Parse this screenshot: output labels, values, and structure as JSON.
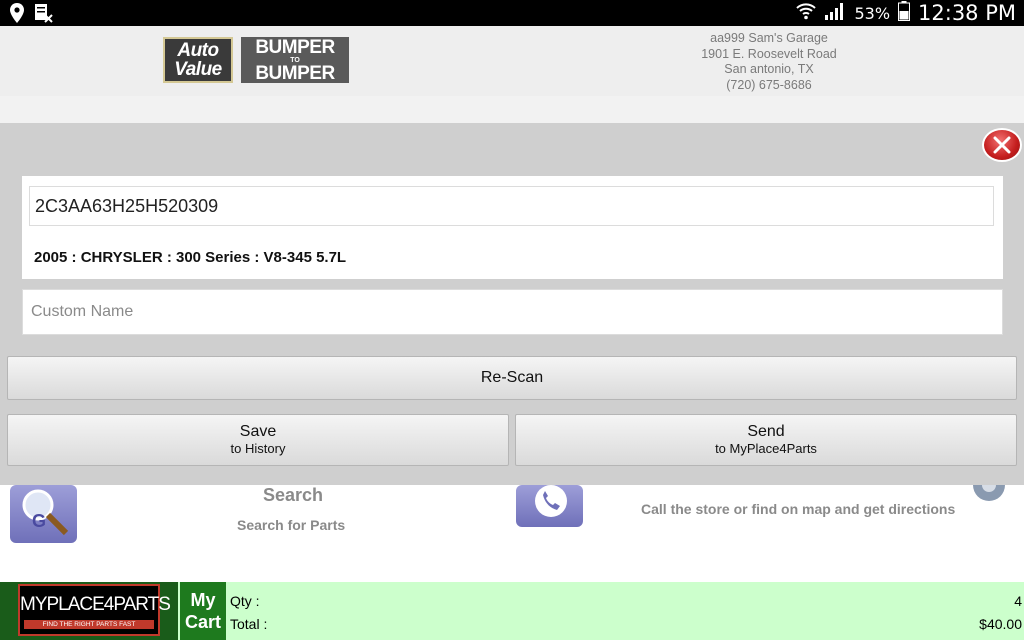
{
  "status_bar": {
    "battery_pct": "53%",
    "time": "12:38 PM"
  },
  "header": {
    "logo_autovalue": [
      "Auto",
      "Value"
    ],
    "logo_b2b": {
      "line1": "BUMPER",
      "mid": "TO",
      "line2": "BUMPER"
    },
    "store": {
      "name": "aa999 Sam's Garage",
      "street": "1901 E. Roosevelt Road",
      "city": "San antonio, TX",
      "phone": "(720) 675-8686"
    }
  },
  "background": {
    "search": {
      "title": "Search",
      "subtitle": "Search for Parts"
    },
    "contact": {
      "subtitle": "Call the store or find on map and get directions"
    }
  },
  "dialog": {
    "vin_value": "2C3AA63H25H520309",
    "vehicle": "2005 : CHRYSLER : 300 Series : V8-345  5.7L",
    "custom_name_placeholder": "Custom Name",
    "rescan_label": "Re-Scan",
    "save": {
      "line1": "Save",
      "line2": "to History"
    },
    "send": {
      "line1": "Send",
      "line2": "to MyPlace4Parts"
    }
  },
  "footer": {
    "brand": "MYPLACE4PARTS",
    "tagline": "FIND THE RIGHT PARTS FAST",
    "my_cart": [
      "My",
      "Cart"
    ],
    "qty_label": "Qty :",
    "qty_value": "4",
    "total_label": "Total :",
    "total_value": "$40.00"
  },
  "colors": {
    "footer_bg": "#ccffcc",
    "cart_green": "#1e7a1e",
    "close_red": "#c41e1e"
  }
}
